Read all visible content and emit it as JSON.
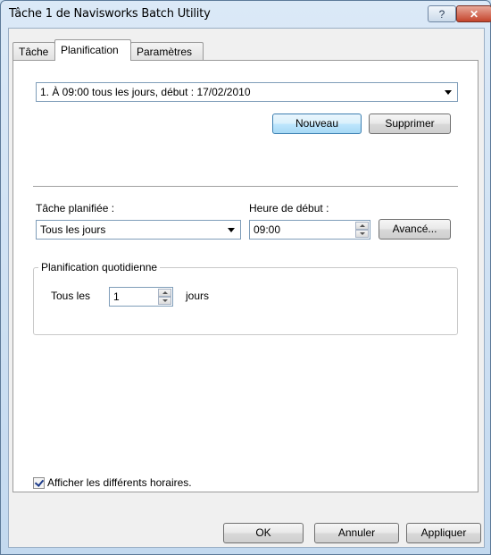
{
  "window": {
    "title": "Tâche 1 de Navisworks Batch Utility",
    "help_glyph": "?",
    "close_glyph": "✕"
  },
  "tabs": [
    {
      "label": "Tâche"
    },
    {
      "label": "Planification",
      "selected": true
    },
    {
      "label": "Paramètres"
    }
  ],
  "schedule": {
    "selected": "1. À 09:00 tous les jours, début : 17/02/2010",
    "new_label": "Nouveau",
    "delete_label": "Supprimer"
  },
  "task": {
    "schedule_label": "Tâche planifiée :",
    "schedule_value": "Tous les jours",
    "start_label": "Heure de début :",
    "start_value": "09:00",
    "advanced_label": "Avancé..."
  },
  "daily": {
    "group_title": "Planification quotidienne",
    "every_label": "Tous les",
    "every_value": "1",
    "unit_label": "jours"
  },
  "show_multiple": {
    "label": "Afficher les différents horaires.",
    "checked": true
  },
  "footer": {
    "ok_label": "OK",
    "cancel_label": "Annuler",
    "apply_label": "Appliquer"
  }
}
